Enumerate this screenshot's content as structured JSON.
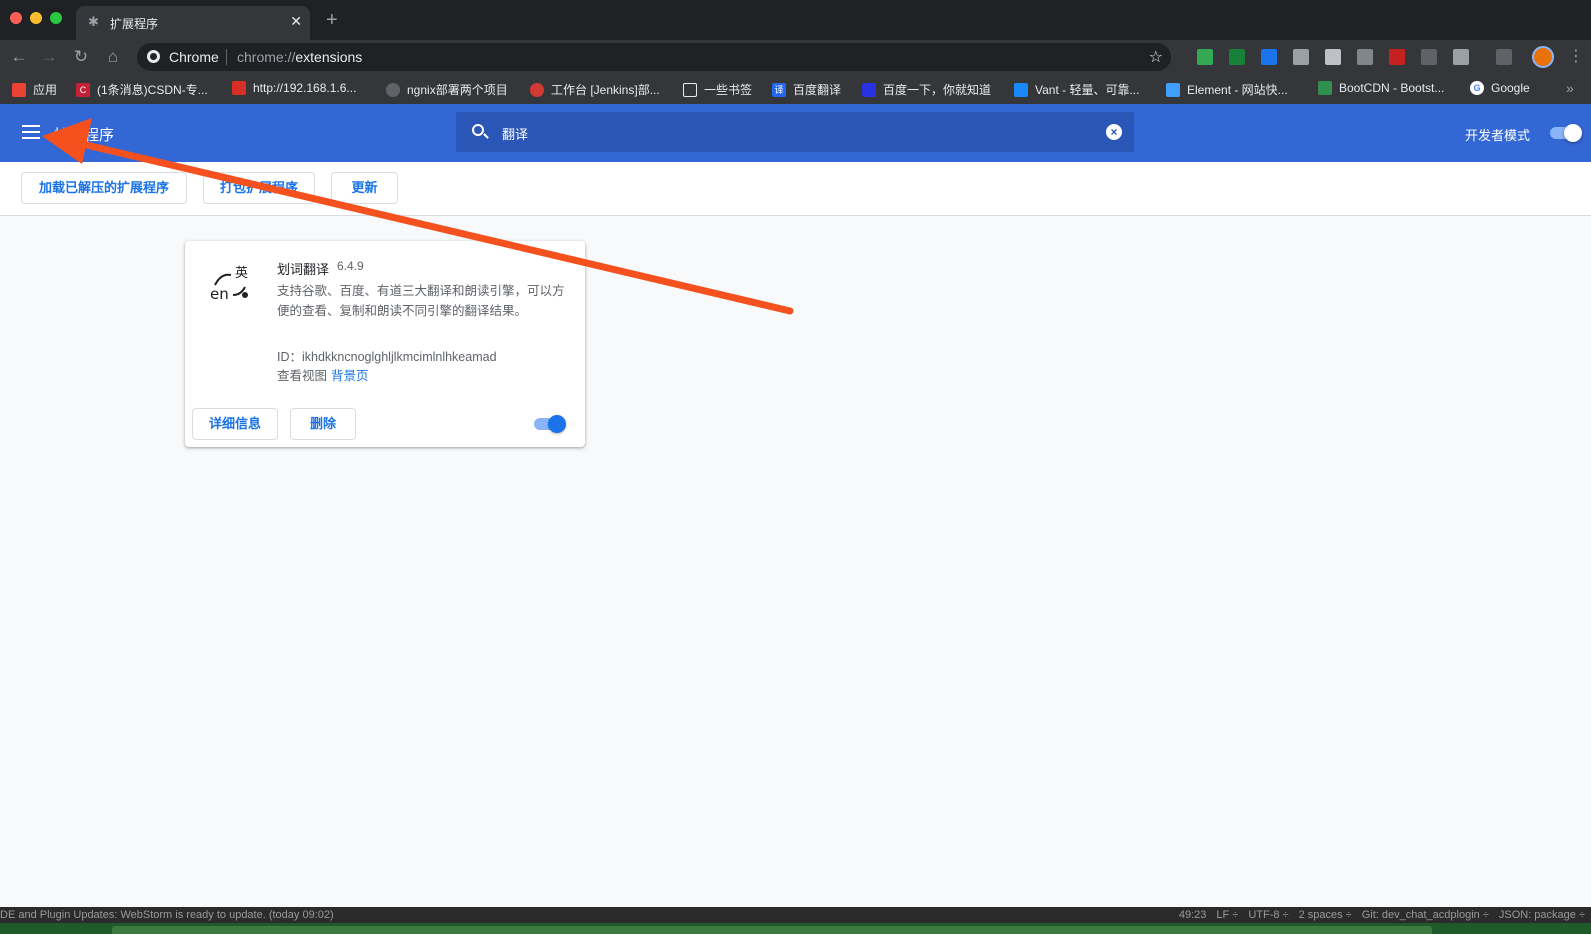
{
  "browser": {
    "tab_title": "扩展程序",
    "tab_close": "✕",
    "new_tab": "+",
    "omnibox_label": "Chrome",
    "url_scheme": "chrome://",
    "url_host": "extensions"
  },
  "bookmarks": [
    {
      "label": "应用",
      "icon": "apps-grid-icon",
      "color": "#ea4335"
    },
    {
      "label": "(1条消息)CSDN-专...",
      "icon": "csdn-icon",
      "color": "#c32136"
    },
    {
      "label": "http://192.168.1.6...",
      "icon": "bookmark-red-icon",
      "color": "#d93025"
    },
    {
      "label": "ngnix部署两个项目",
      "icon": "globe-icon",
      "color": "#5f6368"
    },
    {
      "label": "工作台 [Jenkins]部...",
      "icon": "jenkins-icon",
      "color": "#d33833"
    },
    {
      "label": "一些书签",
      "icon": "folder-icon",
      "color": "#9aa0a6"
    },
    {
      "label": "百度翻译",
      "icon": "baidu-translate-icon",
      "color": "#2468f2"
    },
    {
      "label": "百度一下，你就知道",
      "icon": "baidu-icon",
      "color": "#2932e1"
    },
    {
      "label": "Vant - 轻量、可靠...",
      "icon": "vant-icon",
      "color": "#1989fa"
    },
    {
      "label": "Element - 网站快...",
      "icon": "element-icon",
      "color": "#409eff"
    },
    {
      "label": "BootCDN - Bootst...",
      "icon": "bootcdn-icon",
      "color": "#2f8f4e"
    },
    {
      "label": "Google",
      "icon": "google-icon",
      "color": "#4285f4"
    }
  ],
  "page": {
    "title": "扩展程序",
    "search_value": "翻译",
    "dev_mode_label": "开发者模式",
    "dev_mode_on": true,
    "buttons": {
      "load_unpacked": "加载已解压的扩展程序",
      "pack": "打包扩展程序",
      "update": "更新"
    }
  },
  "extension": {
    "name": "划词翻译",
    "version": "6.4.9",
    "description": "支持谷歌、百度、有道三大翻译和朗读引擎，可以方便的查看、复制和朗读不同引擎的翻译结果。",
    "id_line": "ID：ikhdkkncnoglghljlkmcimlnlhkeamad",
    "views_label": "查看视图",
    "views_link": "背景页",
    "details_button": "详细信息",
    "remove_button": "删除",
    "enabled": true,
    "logo_text_top": "英",
    "logo_text_bottom": "en"
  },
  "ide_status": {
    "message": "DE and Plugin Updates: WebStorm is ready to update. (today 09:02)",
    "position": "49:23",
    "line_sep": "LF ÷",
    "encoding": "UTF-8 ÷",
    "indent": "2 spaces ÷",
    "git": "Git: dev_chat_acdplogin ÷",
    "schema": "JSON: package ÷"
  },
  "colors": {
    "header": "#3367d6",
    "accent": "#1a73e8",
    "arrow": "#f4511e"
  }
}
